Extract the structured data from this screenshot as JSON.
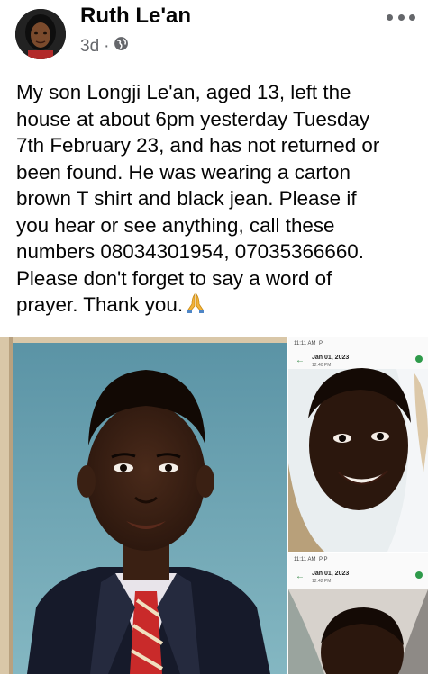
{
  "post": {
    "author": "Ruth Le'an",
    "time": "3d",
    "separator": "·",
    "privacy_icon": "globe-icon",
    "more_icon": "more-options-icon",
    "text_lines": [
      "My son Longji Le'an, aged 13, left the",
      "house at about 6pm yesterday Tuesday",
      "7th February 23, and has not returned or",
      "been found.  He was wearing a carton",
      "brown T shirt and black jean. Please if",
      "you hear or see anything, call these",
      "numbers 08034301954,    07035366660.",
      "Please don't forget to say a word of",
      "prayer. Thank you."
    ],
    "emoji_icon": "praying-hands-icon"
  },
  "photos": {
    "top_right": {
      "status_time": "11:11 AM",
      "status_icons": "P",
      "date": "Jan 01, 2023",
      "time": "12:40 PM"
    },
    "bottom_right": {
      "status_time": "11:11 AM",
      "status_icons": "P P",
      "date": "Jan 01, 2023",
      "time": "12:42 PM"
    }
  },
  "colors": {
    "text": "#050505",
    "secondary": "#65676b",
    "accent_green": "#2e9a4a"
  }
}
